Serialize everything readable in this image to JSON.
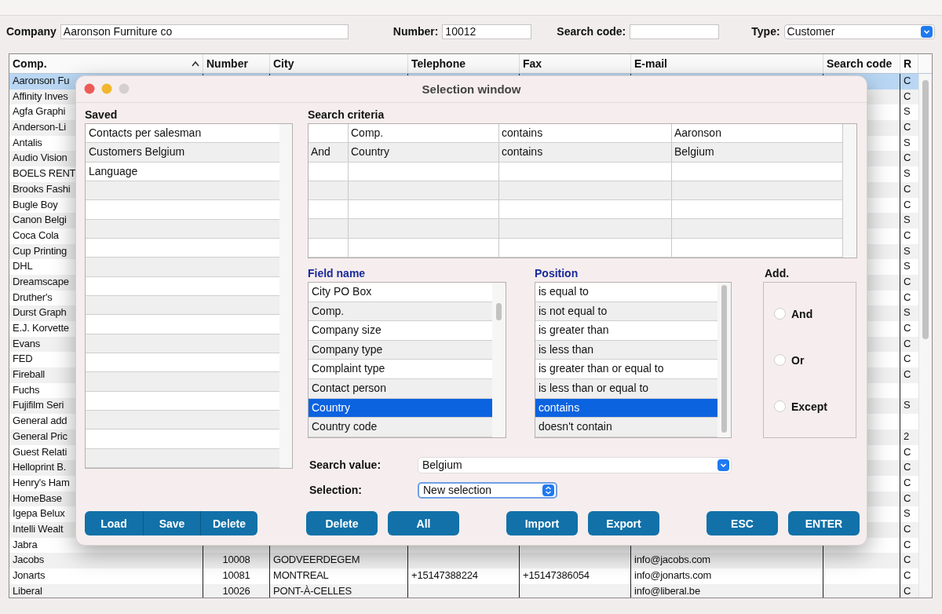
{
  "filters": [
    {
      "label": "Company",
      "value": "Aaronson Furniture co",
      "kind": "text"
    },
    {
      "label": "Number:",
      "value": "10012",
      "kind": "text"
    },
    {
      "label": "Search code:",
      "kind": "text"
    },
    {
      "label": "Type:",
      "value": "Customer",
      "kind": "select"
    }
  ],
  "table": {
    "columns": [
      {
        "label": "Comp.",
        "sorted": true
      },
      {
        "label": "Number",
        "sorted": false
      },
      {
        "label": "City",
        "sorted": false
      },
      {
        "label": "Telephone",
        "sorted": false
      },
      {
        "label": "Fax",
        "sorted": false
      },
      {
        "label": "E-mail",
        "sorted": false
      },
      {
        "label": "Search code",
        "sorted": false
      },
      {
        "label": "R",
        "sorted": false
      }
    ],
    "rows": [
      {
        "comp": "Aaronson Fu",
        "r": "C",
        "selected": true
      },
      {
        "comp": "Affinity Inves",
        "r": "C",
        "selected": false
      },
      {
        "comp": "Agfa Graphi",
        "r": "S",
        "selected": false
      },
      {
        "comp": "Anderson-Li",
        "r": "C",
        "selected": false
      },
      {
        "comp": "Antalis",
        "r": "S",
        "selected": false
      },
      {
        "comp": "Audio Vision",
        "r": "C",
        "selected": false
      },
      {
        "comp": "BOELS RENT",
        "r": "S",
        "selected": false
      },
      {
        "comp": "Brooks Fashi",
        "r": "C",
        "selected": false
      },
      {
        "comp": "Bugle Boy",
        "r": "C",
        "selected": false
      },
      {
        "comp": "Canon Belgi",
        "r": "S",
        "selected": false
      },
      {
        "comp": "Coca Cola",
        "r": "C",
        "selected": false
      },
      {
        "comp": "Cup Printing",
        "r": "S",
        "selected": false
      },
      {
        "comp": "DHL",
        "r": "S",
        "selected": false
      },
      {
        "comp": "Dreamscape",
        "r": "C",
        "selected": false
      },
      {
        "comp": "Druther's",
        "r": "C",
        "selected": false
      },
      {
        "comp": "Durst Graph",
        "r": "S",
        "selected": false
      },
      {
        "comp": "E.J. Korvette",
        "r": "C",
        "selected": false
      },
      {
        "comp": "Evans",
        "r": "C",
        "selected": false
      },
      {
        "comp": "FED",
        "r": "C",
        "selected": false
      },
      {
        "comp": "Fireball",
        "r": "C",
        "selected": false
      },
      {
        "comp": "Fuchs",
        "selected": false
      },
      {
        "comp": "Fujifilm Seri",
        "r": "S",
        "selected": false
      },
      {
        "comp": "General add",
        "selected": false
      },
      {
        "comp": "General Pric",
        "r": "2",
        "selected": false
      },
      {
        "comp": "Guest Relati",
        "r": "C",
        "selected": false
      },
      {
        "comp": "Helloprint B.",
        "r": "C",
        "selected": false
      },
      {
        "comp": "Henry's Ham",
        "r": "C",
        "selected": false
      },
      {
        "comp": "HomeBase",
        "r": "C",
        "selected": false
      },
      {
        "comp": "Igepa Belux",
        "r": "S",
        "selected": false
      },
      {
        "comp": "Intelli Wealt",
        "r": "C",
        "selected": false
      },
      {
        "comp": "Jabra",
        "r": "C",
        "selected": false
      },
      {
        "comp": "Jacobs",
        "number": "10008",
        "city": "GODVEERDEGEM",
        "email": "info@jacobs.com",
        "r": "C",
        "selected": false
      },
      {
        "comp": "Jonarts",
        "number": "10081",
        "city": "MONTREAL",
        "telephone": "+15147388224",
        "fax": "+15147386054",
        "email": "info@jonarts.com",
        "r": "C",
        "selected": false
      },
      {
        "comp": "Liberal",
        "number": "10026",
        "city": "PONT-À-CELLES",
        "email": "info@liberal.be",
        "r": "C",
        "selected": false
      }
    ]
  },
  "dialog": {
    "title": "Selection window",
    "saved": {
      "label": "Saved",
      "items": [
        "Contacts per salesman",
        "Customers Belgium",
        "Language"
      ]
    },
    "saved_buttons": [
      "Load",
      "Save",
      "Delete"
    ],
    "criteria": {
      "label": "Search criteria",
      "rows": [
        {
          "field": "Comp.",
          "operator": "contains",
          "value": "Aaronson"
        },
        {
          "conjunction": "And",
          "field": "Country",
          "operator": "contains",
          "value": "Belgium"
        }
      ]
    },
    "field_name": {
      "label": "Field name",
      "items": [
        {
          "text": "City PO Box",
          "selected": false
        },
        {
          "text": "Comp.",
          "selected": false
        },
        {
          "text": "Company size",
          "selected": false
        },
        {
          "text": "Company type",
          "selected": false
        },
        {
          "text": "Complaint type",
          "selected": false
        },
        {
          "text": "Contact person",
          "selected": false
        },
        {
          "text": "Country",
          "selected": true
        },
        {
          "text": "Country code",
          "selected": false
        }
      ]
    },
    "position": {
      "label": "Position",
      "items": [
        {
          "text": "is equal to",
          "selected": false
        },
        {
          "text": "is not equal to",
          "selected": false
        },
        {
          "text": "is greater than",
          "selected": false
        },
        {
          "text": "is less than",
          "selected": false
        },
        {
          "text": "is greater than or equal to",
          "selected": false
        },
        {
          "text": "is less than or equal to",
          "selected": false
        },
        {
          "text": "contains",
          "selected": true
        },
        {
          "text": "doesn't contain",
          "selected": false
        }
      ]
    },
    "add": {
      "label": "Add.",
      "options": [
        {
          "label": "And",
          "selected": false
        },
        {
          "label": "Or",
          "selected": false
        },
        {
          "label": "Except",
          "selected": false
        }
      ]
    },
    "search_value": {
      "label": "Search value:",
      "value": "Belgium"
    },
    "selection": {
      "label": "Selection:",
      "value": "New selection"
    },
    "button_groups": [
      [
        "Delete",
        "All"
      ],
      [
        "Import",
        "Export"
      ],
      [
        "ESC",
        "ENTER"
      ]
    ]
  }
}
